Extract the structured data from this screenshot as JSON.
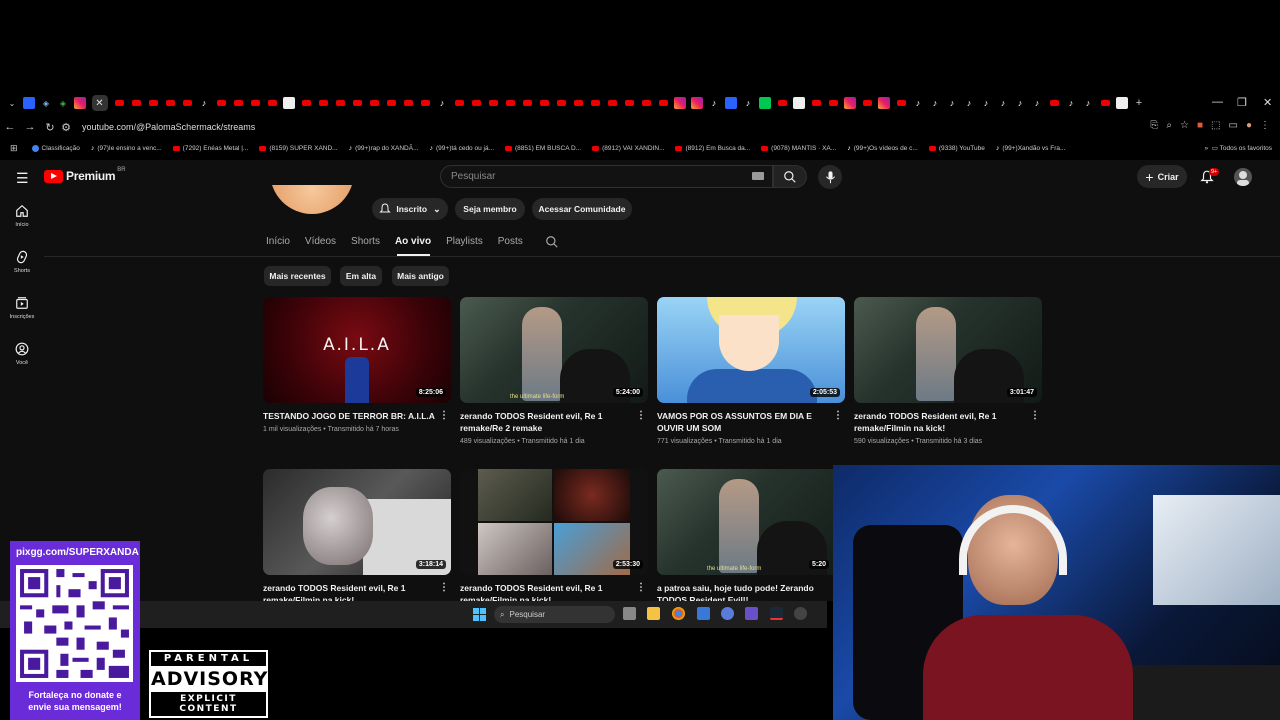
{
  "browser": {
    "url": "youtube.com/@PalomaSchermack/streams",
    "bookmarks": [
      {
        "icon": "chrome",
        "label": "Classificação"
      },
      {
        "icon": "tiktok",
        "label": "(97)Ie ensino a venc..."
      },
      {
        "icon": "youtube",
        "label": "(7292) Enéas Metal |..."
      },
      {
        "icon": "youtube",
        "label": "(8159) SUPER XAND..."
      },
      {
        "icon": "tiktok",
        "label": "(99+)rap do XANDÃ..."
      },
      {
        "icon": "tiktok",
        "label": "(99+)tá cedo ou já..."
      },
      {
        "icon": "youtube",
        "label": "(8851) EM BUSCA D..."
      },
      {
        "icon": "youtube",
        "label": "(8912) VAI XANDIN..."
      },
      {
        "icon": "youtube",
        "label": "(8912) Em Busca da..."
      },
      {
        "icon": "youtube",
        "label": "(9078) MANTIS · XA..."
      },
      {
        "icon": "tiktok",
        "label": "(99+)Os vídeos de c..."
      },
      {
        "icon": "youtube",
        "label": "(9338) YouTube"
      },
      {
        "icon": "tiktok",
        "label": "(99+)Xandão vs Fra..."
      }
    ],
    "all_favorites": "Todos os favoritos"
  },
  "youtube": {
    "logo_text": "Premium",
    "country": "BR",
    "search_placeholder": "Pesquisar",
    "create_label": "Criar",
    "notification_badge": "9+",
    "sidebar": [
      {
        "label": "Início",
        "icon": "home-icon"
      },
      {
        "label": "Shorts",
        "icon": "shorts-icon"
      },
      {
        "label": "Inscrições",
        "icon": "subscriptions-icon"
      },
      {
        "label": "Você",
        "icon": "you-icon"
      }
    ],
    "channel_buttons": {
      "subscribed": "Inscrito",
      "member": "Seja membro",
      "community": "Acessar Comunidade"
    },
    "tabs": [
      "Início",
      "Vídeos",
      "Shorts",
      "Ao vivo",
      "Playlists",
      "Posts"
    ],
    "active_tab": "Ao vivo",
    "chips": [
      "Mais recentes",
      "Em alta",
      "Mais antigo"
    ],
    "videos": [
      {
        "title": "TESTANDO JOGO DE TERROR BR: A.I.L.A",
        "views": "1 mil visualizações",
        "when": "Transmitido há 7 horas",
        "duration": "8:25:06",
        "thumb_text": "A.I.L.A"
      },
      {
        "title": "zerando TODOS Resident evil, Re 1 remake/Re 2 remake",
        "views": "489 visualizações",
        "when": "Transmitido há 1 dia",
        "duration": "5:24:00",
        "thumb_text": "the ultimate life-form"
      },
      {
        "title": "VAMOS POR OS ASSUNTOS EM DIA E OUVIR UM SOM",
        "views": "771 visualizações",
        "when": "Transmitido há 1 dia",
        "duration": "2:05:53"
      },
      {
        "title": "zerando TODOS Resident evil, Re 1 remake/Filmin na kick!",
        "views": "590 visualizações",
        "when": "Transmitido há 3 dias",
        "duration": "3:01:47"
      },
      {
        "title": "zerando TODOS Resident evil, Re 1 remake/Filmin na kick!",
        "views": "",
        "when": "",
        "duration": "3:18:14"
      },
      {
        "title": "zerando TODOS Resident evil, Re 1 remake/Filmin na kick!",
        "views": "",
        "when": "",
        "duration": "2:53:30"
      },
      {
        "title": "a patroa saiu, hoje tudo pode! Zerando TODOS Resident Evil!!",
        "views": "",
        "when": "",
        "duration": "5:20",
        "thumb_text": "the ultimate life-form"
      }
    ]
  },
  "taskbar": {
    "search_label": "Pesquisar"
  },
  "overlay": {
    "pix_url": "pixgg.com/SUPERXANDA",
    "pix_message_1": "Fortaleça no donate e",
    "pix_message_2": "envie sua mensagem!",
    "advisory_1": "PARENTAL",
    "advisory_2": "ADVISORY",
    "advisory_3": "EXPLICIT CONTENT"
  }
}
